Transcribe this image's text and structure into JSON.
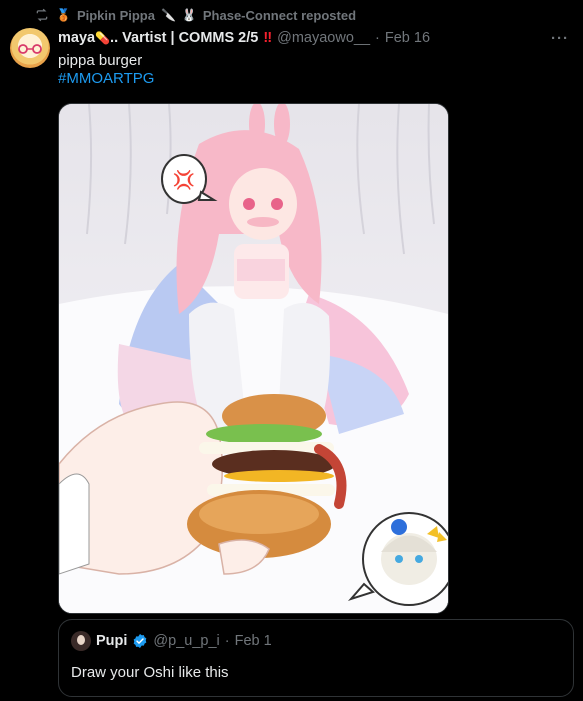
{
  "repost": {
    "user": "Pipkin Pippa",
    "tool_emoji": "🔪",
    "bunny_emoji": "🐰",
    "suffix": "Phase-Connect reposted",
    "medal_emoji": "🥉"
  },
  "tweet": {
    "author_name": "maya",
    "author_emoji": "💊",
    "author_suffix": ".. Vartist | COMMS 2/5",
    "author_bangs": "‼",
    "handle": "@mayaowo__",
    "separator": "·",
    "date": "Feb 16",
    "text": "pippa burger",
    "hashtag": "#MMOARTPG",
    "more": "···"
  },
  "media": {
    "icon": "artwork-image",
    "speech_symbol": "💢"
  },
  "quote": {
    "author_name": "Pupi",
    "handle": "@p_u_p_i",
    "separator": "·",
    "date": "Feb 1",
    "text": "Draw your Oshi like this"
  },
  "colors": {
    "background": "#000000",
    "text": "#e7e9ea",
    "muted": "#71767b",
    "accent": "#1d9bf0",
    "border": "#2f3336"
  }
}
